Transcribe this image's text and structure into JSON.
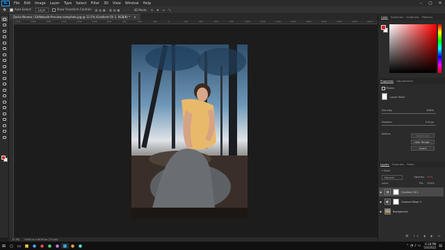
{
  "menubar": {
    "logo": "Ps",
    "items": [
      "File",
      "Edit",
      "Image",
      "Layer",
      "Type",
      "Select",
      "Filter",
      "3D",
      "View",
      "Window",
      "Help"
    ],
    "window_controls": [
      "–",
      "▢",
      "✕"
    ]
  },
  "options_bar": {
    "auto_select_label": "Auto-Select:",
    "auto_select_target": "Layer",
    "show_transform_label": "Show Transform Controls",
    "mode_label": "3D Mode:"
  },
  "document": {
    "tab_title": "Dariia Nevera / Ed/Nobuth-Preview-compfade.jpg @ 12.5% (Gradient Fill 1, RGB/8) *",
    "close_glyph": "×",
    "ruler_marks": [
      "2000",
      "1800",
      "1600",
      "1400",
      "1200",
      "1000",
      "800",
      "600",
      "400",
      "200",
      "0",
      "200",
      "400",
      "600",
      "800",
      "1000",
      "1200",
      "1400",
      "1600",
      "1800",
      "2000",
      "2200",
      "2400",
      "2600"
    ]
  },
  "status": {
    "zoom": "12.5%",
    "doc_info": "4000 px x 6016 px (72 ppi)"
  },
  "color_panel": {
    "tabs": [
      "Color",
      "Swatches",
      "Gradients",
      "Patterns"
    ],
    "active_tab": "Color",
    "foreground": "#e02020",
    "background": "#ffffff"
  },
  "properties_panel": {
    "tabs": [
      "Properties",
      "Adjustments"
    ],
    "type_label": "Masks",
    "mask_label": "Layer Mask",
    "density_label": "Density:",
    "density_value": "100%",
    "feather_label": "Feather:",
    "feather_value": "0.0 px",
    "refine_label": "Refine:",
    "select_and_mask": "Select and Mask...",
    "color_range": "Color Range...",
    "invert": "Invert"
  },
  "layers_panel": {
    "tabs": [
      "Layers",
      "Channels",
      "Paths"
    ],
    "filter_label": "Kind",
    "blend_mode": "Normal",
    "opacity_label": "Opacity:",
    "opacity_value": "53%",
    "lock_label": "Lock:",
    "fill_label": "Fill:",
    "fill_value": "100%",
    "layers": [
      {
        "name": "Gradient Fill 1",
        "kind": "adjustment",
        "selected": true
      },
      {
        "name": "Channel Mixer 1",
        "kind": "adjustment",
        "selected": false
      },
      {
        "name": "Background",
        "kind": "image",
        "selected": false
      }
    ]
  },
  "taskbar": {
    "time": "6:18 PM",
    "date": "5/4/2022"
  },
  "icons": {
    "window_glyph": "⊞",
    "search_glyph": "○",
    "eye_glyph": "◉",
    "adjust_glyph": "◐",
    "gradient_glyph": "▨",
    "lock_glyph": "🔒"
  }
}
